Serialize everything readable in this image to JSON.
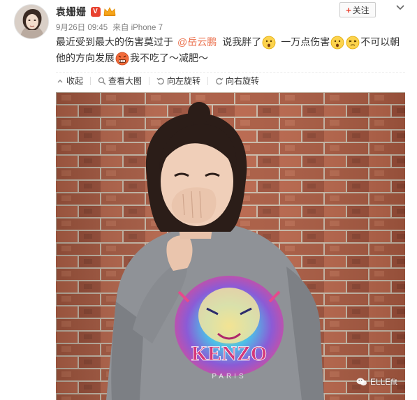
{
  "post": {
    "user_name": "袁姗姗",
    "verify_mark": "V",
    "follow_label": "关注",
    "date": "9月26日 09:45",
    "source": "来自 iPhone 7",
    "text": {
      "line1_a": "最近受到最大的伤害莫过于",
      "mention": "@岳云鹏",
      "line1_b": "说我胖了",
      "line1_c": "一万点伤害",
      "line1_d": "不可以朝",
      "line2_a": "他的方向发展",
      "line2_b": "我不吃了～减肥～"
    },
    "emojis": [
      "surprised-emoji",
      "surprised-emoji",
      "dizzy-emoji",
      "angry-emoji"
    ],
    "accent_color": "#eb7350"
  },
  "toolbar": {
    "collapse_label": "收起",
    "view_large_label": "查看大图",
    "rotate_left_label": "向左旋转",
    "rotate_right_label": "向右旋转"
  },
  "photo": {
    "sweater_text": "KENZO",
    "sweater_subtext": "PARIS"
  },
  "watermark": {
    "label": "ELLEfit"
  }
}
